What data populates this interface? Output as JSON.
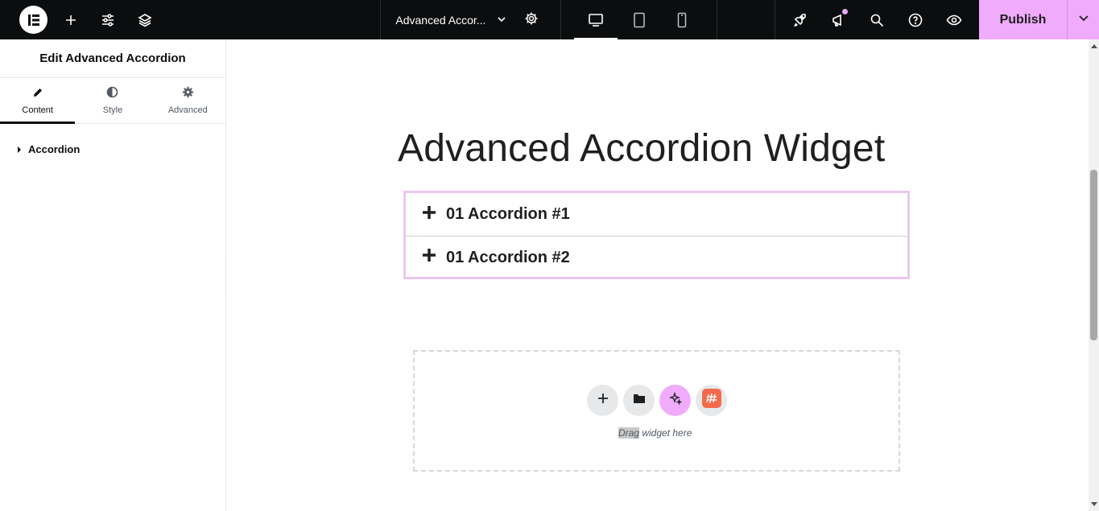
{
  "topbar": {
    "document_title": "Advanced Accor...",
    "publish_label": "Publish",
    "icons": {
      "logo": "elementor-logo-icon",
      "add": "plus-icon",
      "settings": "sliders-icon",
      "structure": "layers-icon",
      "doc_dropdown": "chevron-down-icon",
      "doc_settings": "gear-icon",
      "desktop": "desktop-icon",
      "tablet": "tablet-icon",
      "mobile": "mobile-icon",
      "launchpad": "rocket-icon",
      "whats_new": "megaphone-icon",
      "search": "search-icon",
      "help": "help-icon",
      "preview": "eye-icon",
      "publish_more": "chevron-down-icon"
    },
    "accent_color": "#f0abfc"
  },
  "panel": {
    "title": "Edit Advanced Accordion",
    "tabs": [
      {
        "label": "Content",
        "icon": "pencil-icon",
        "active": true
      },
      {
        "label": "Style",
        "icon": "half-circle-icon",
        "active": false
      },
      {
        "label": "Advanced",
        "icon": "gear-icon",
        "active": false
      }
    ],
    "section_label": "Accordion"
  },
  "canvas": {
    "heading": "Advanced Accordion Widget",
    "accordion_items": [
      {
        "label": "01 Accordion #1"
      },
      {
        "label": "01 Accordion #2"
      }
    ],
    "dropzone": {
      "highlight": "Drag",
      "text": " widget here"
    }
  }
}
